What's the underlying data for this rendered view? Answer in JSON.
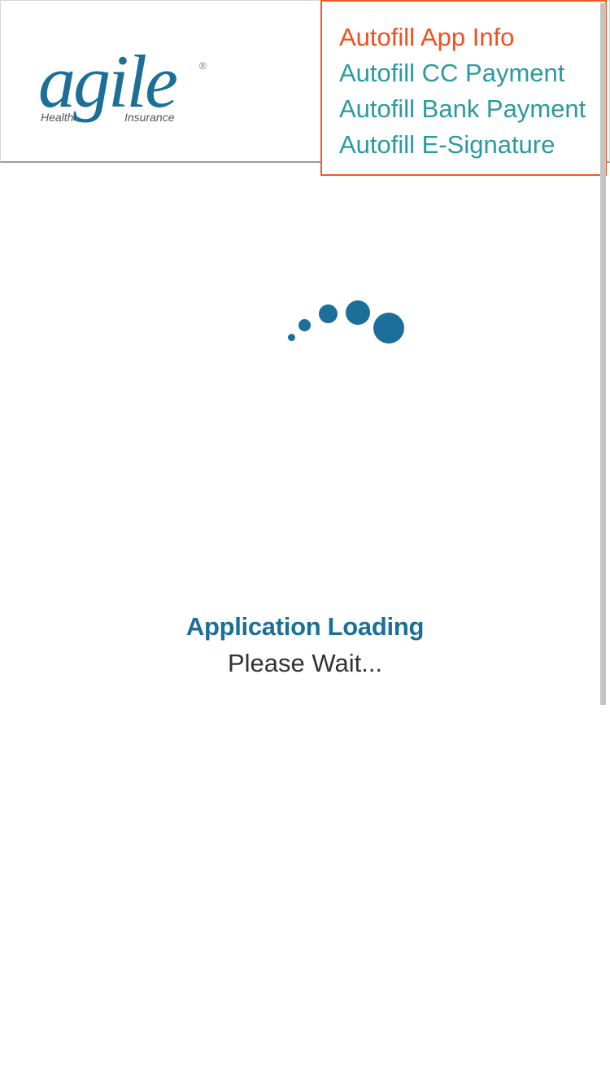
{
  "brand": {
    "logo_word": "agile",
    "logo_tagline_left": "Health",
    "logo_tagline_right": "Insurance",
    "registered_mark": "®",
    "color": "#1b6f98"
  },
  "autofill_menu": {
    "items": [
      {
        "label": "Autofill App Info",
        "active": true
      },
      {
        "label": "Autofill CC Payment",
        "active": false
      },
      {
        "label": "Autofill Bank Payment",
        "active": false
      },
      {
        "label": "Autofill E-Signature",
        "active": false
      }
    ],
    "active_color": "#f0501e",
    "link_color": "#2a9aa0",
    "border_color": "#f05a22"
  },
  "loading": {
    "title": "Application Loading",
    "subtitle": "Please Wait...",
    "spinner_icon": "loading-dots-icon"
  }
}
